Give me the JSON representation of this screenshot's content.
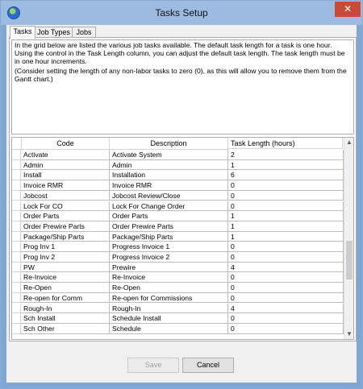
{
  "window": {
    "title": "Tasks Setup",
    "close_glyph": "✕"
  },
  "tabs": [
    {
      "label": "Tasks"
    },
    {
      "label": "Job Types"
    },
    {
      "label": "Jobs"
    }
  ],
  "description": {
    "paragraph1": "In the grid below are listed the various job tasks available.  The default task length for a task is one hour.  Using the control in the Task Length column, you can adjust the default task length.  The task length must be in one hour increments.",
    "paragraph2": "(Consider setting the length of any non-labor tasks to zero (0), as this will allow you to remove them from the Gantt chart.)"
  },
  "grid": {
    "columns": {
      "code": "Code",
      "description": "Description",
      "length": "Task Length (hours)"
    },
    "rows": [
      {
        "code": "Activate",
        "description": "Activate System",
        "length": "2"
      },
      {
        "code": "Admin",
        "description": "Admin",
        "length": "1"
      },
      {
        "code": "Install",
        "description": "Installation",
        "length": "6"
      },
      {
        "code": "Invoice RMR",
        "description": "Invoice RMR",
        "length": "0"
      },
      {
        "code": "Jobcost",
        "description": "Jobcost Review/Close",
        "length": "0"
      },
      {
        "code": "Lock For CO",
        "description": "Lock For Change Order",
        "length": "0"
      },
      {
        "code": "Order Parts",
        "description": "Order Parts",
        "length": "1"
      },
      {
        "code": "Order Prewire Parts",
        "description": "Order Prewire Parts",
        "length": "1"
      },
      {
        "code": "Package/Ship Parts",
        "description": "Package/Ship Parts",
        "length": "1"
      },
      {
        "code": "Prog Inv 1",
        "description": "Progress Invoice 1",
        "length": "0"
      },
      {
        "code": "Prog Inv 2",
        "description": "Progress Invoice 2",
        "length": "0"
      },
      {
        "code": "PW",
        "description": "Prewire",
        "length": "4"
      },
      {
        "code": "Re-Invoice",
        "description": "Re-Invoice",
        "length": "0"
      },
      {
        "code": "Re-Open",
        "description": "Re-Open",
        "length": "0"
      },
      {
        "code": "Re-open for Comm",
        "description": "Re-open for Commissions",
        "length": "0"
      },
      {
        "code": "Rough-In",
        "description": "Rough-In",
        "length": "4"
      },
      {
        "code": "Sch Install",
        "description": "Schedule Install",
        "length": "0"
      },
      {
        "code": "Sch Other",
        "description": "Schedule",
        "length": "0"
      }
    ]
  },
  "scrollbar": {
    "up_glyph": "▲",
    "down_glyph": "▼"
  },
  "buttons": {
    "save": "Save",
    "cancel": "Cancel"
  }
}
